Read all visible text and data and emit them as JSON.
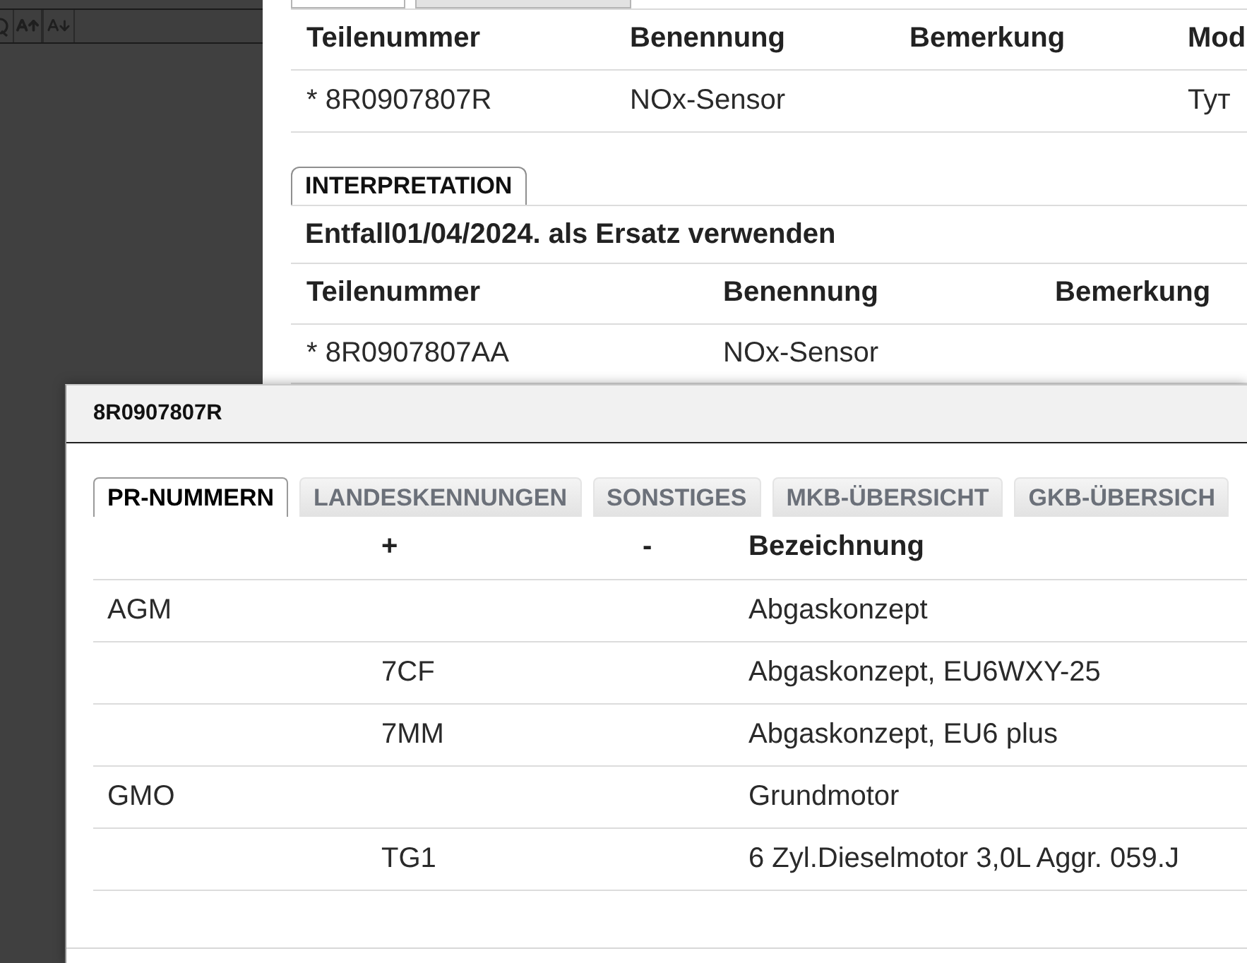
{
  "top_tabs": [
    {
      "selected": true
    },
    {
      "selected": false
    }
  ],
  "parts_table": {
    "columns": [
      "Teilenummer",
      "Benennung",
      "Bemerkung",
      "Mod"
    ],
    "rows": [
      [
        "* 8R0907807R",
        "NOx-Sensor",
        null,
        "Тут"
      ]
    ]
  },
  "interpretation": {
    "tab_label": "INTERPRETATION",
    "note": "Entfall01/04/2024. als Ersatz verwenden",
    "columns": [
      "Teilenummer",
      "Benennung",
      "Bemerkung"
    ],
    "rows": [
      [
        "* 8R0907807AA",
        "NOx-Sensor",
        null
      ]
    ]
  },
  "dialog": {
    "title": "8R0907807R",
    "tabs": [
      {
        "label": "PR-NUMMERN",
        "selected": true
      },
      {
        "label": "LANDESKENNUNGEN",
        "selected": false
      },
      {
        "label": "SONSTIGES",
        "selected": false
      },
      {
        "label": "MKB-ÜBERSICHT",
        "selected": false
      },
      {
        "label": "GKB-ÜBERSICH",
        "selected": false
      }
    ],
    "table": {
      "columns": [
        null,
        "+",
        "-",
        "Bezeichnung"
      ],
      "rows": [
        [
          "AGM",
          null,
          null,
          "Abgaskonzept"
        ],
        [
          null,
          "7CF",
          null,
          "Abgaskonzept, EU6WXY-25"
        ],
        [
          null,
          "7MM",
          null,
          "Abgaskonzept, EU6 plus"
        ],
        [
          "GMO",
          null,
          null,
          "Grundmotor"
        ],
        [
          null,
          "TG1",
          null,
          "6 Zyl.Dieselmotor 3,0L Aggr. 059.J"
        ]
      ]
    }
  }
}
